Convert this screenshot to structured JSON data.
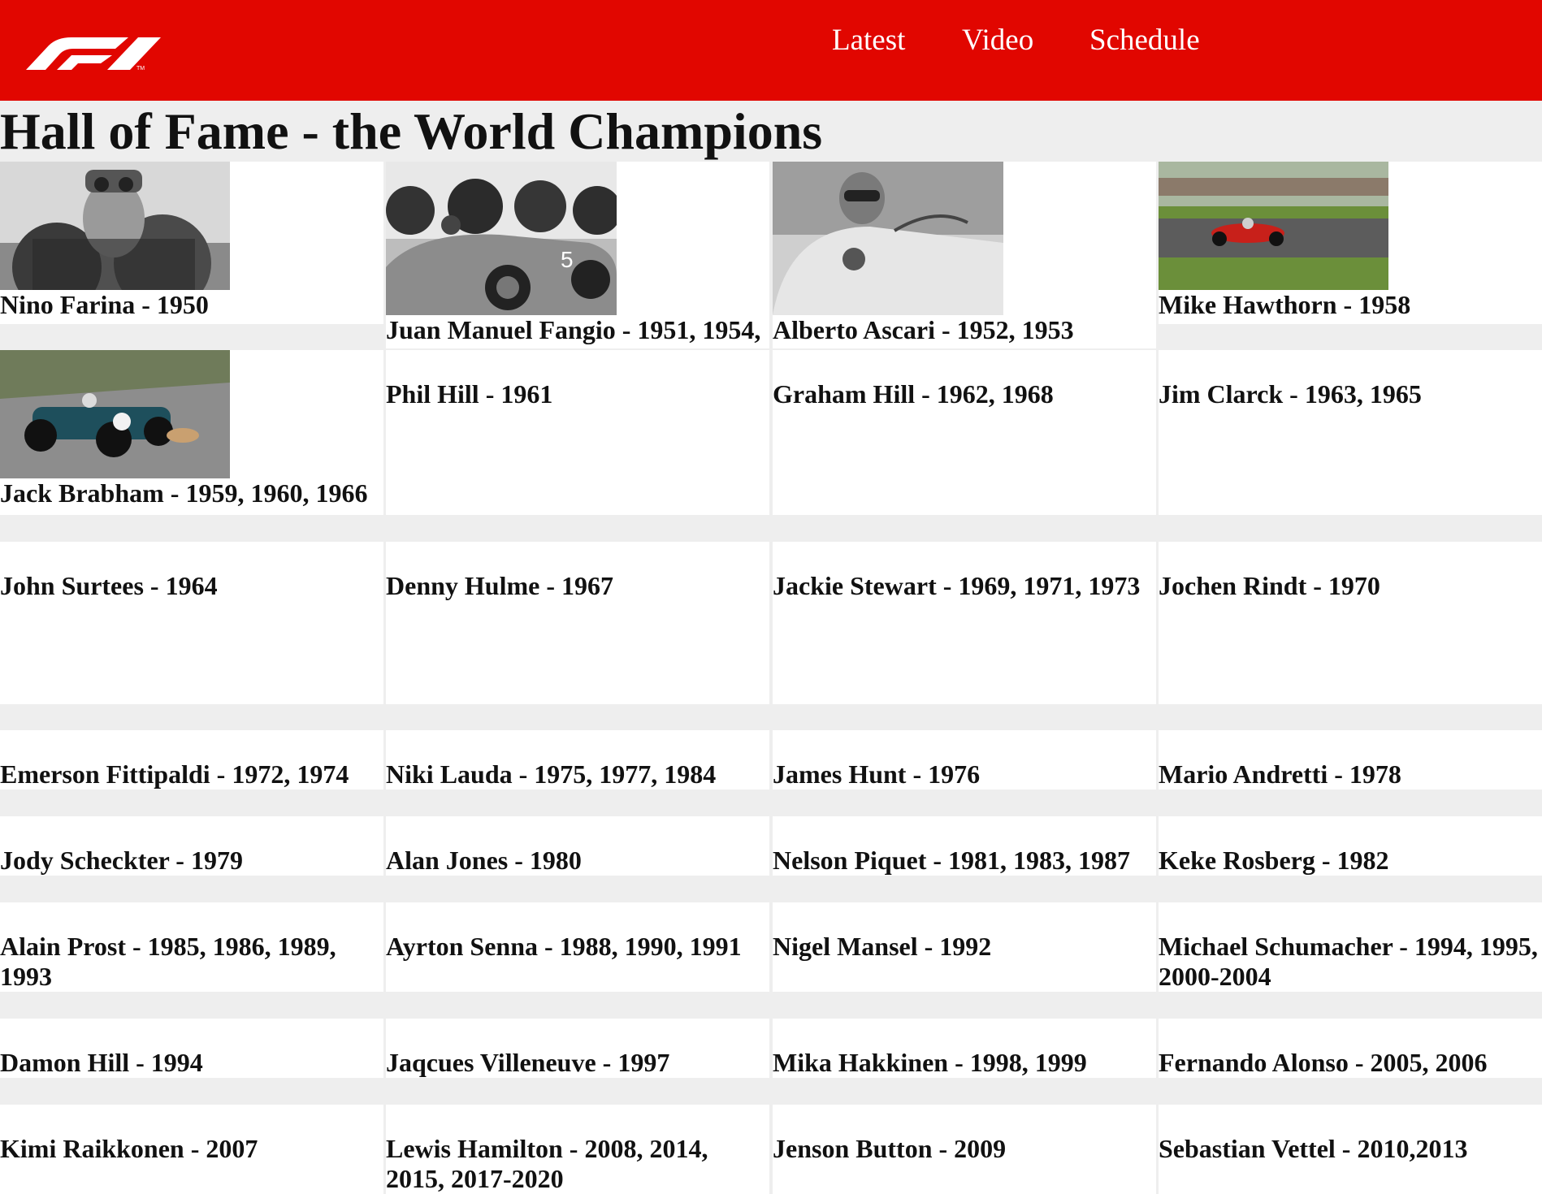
{
  "nav": {
    "brand_logo": "f1-logo",
    "latest": "Latest",
    "video": "Video",
    "schedule": "Schedule"
  },
  "page": {
    "title": "Hall of Fame - the World Champions"
  },
  "colors": {
    "brand_red": "#e10600",
    "page_background": "#eeeeee",
    "card_background": "#ffffff"
  },
  "champions": [
    {
      "label": "Nino Farina - 1950",
      "photo": "nino-farina-photo"
    },
    {
      "label": "Juan Manuel Fangio - 1951, 1954,",
      "photo": "juan-manuel-fangio-photo"
    },
    {
      "label": "Alberto Ascari - 1952, 1953",
      "photo": "alberto-ascari-photo"
    },
    {
      "label": "Mike Hawthorn - 1958",
      "photo": "mike-hawthorn-photo"
    },
    {
      "label": "Jack Brabham - 1959, 1960, 1966",
      "photo": "jack-brabham-photo"
    },
    {
      "label": "Phil Hill - 1961"
    },
    {
      "label": "Graham Hill - 1962, 1968"
    },
    {
      "label": "Jim Clarck - 1963, 1965"
    },
    {
      "label": "John Surtees - 1964"
    },
    {
      "label": "Denny Hulme - 1967"
    },
    {
      "label": "Jackie Stewart - 1969, 1971, 1973"
    },
    {
      "label": "Jochen Rindt - 1970"
    },
    {
      "label": "Emerson Fittipaldi - 1972, 1974"
    },
    {
      "label": "Niki Lauda - 1975, 1977, 1984"
    },
    {
      "label": "James Hunt - 1976"
    },
    {
      "label": "Mario Andretti - 1978"
    },
    {
      "label": "Jody Scheckter - 1979"
    },
    {
      "label": "Alan Jones - 1980"
    },
    {
      "label": "Nelson Piquet - 1981, 1983, 1987"
    },
    {
      "label": "Keke Rosberg - 1982"
    },
    {
      "label": "Alain Prost - 1985, 1986, 1989, 1993"
    },
    {
      "label": "Ayrton Senna - 1988, 1990, 1991"
    },
    {
      "label": "Nigel Mansel - 1992"
    },
    {
      "label": "Michael Schumacher - 1994, 1995, 2000-2004"
    },
    {
      "label": "Damon Hill - 1994"
    },
    {
      "label": "Jaqcues Villeneuve - 1997"
    },
    {
      "label": "Mika Hakkinen - 1998, 1999"
    },
    {
      "label": "Fernando Alonso - 2005, 2006"
    },
    {
      "label": "Kimi Raikkonen - 2007"
    },
    {
      "label": "Lewis Hamilton - 2008, 2014, 2015, 2017-2020"
    },
    {
      "label": "Jenson Button - 2009"
    },
    {
      "label": "Sebastian Vettel - 2010,2013"
    }
  ]
}
